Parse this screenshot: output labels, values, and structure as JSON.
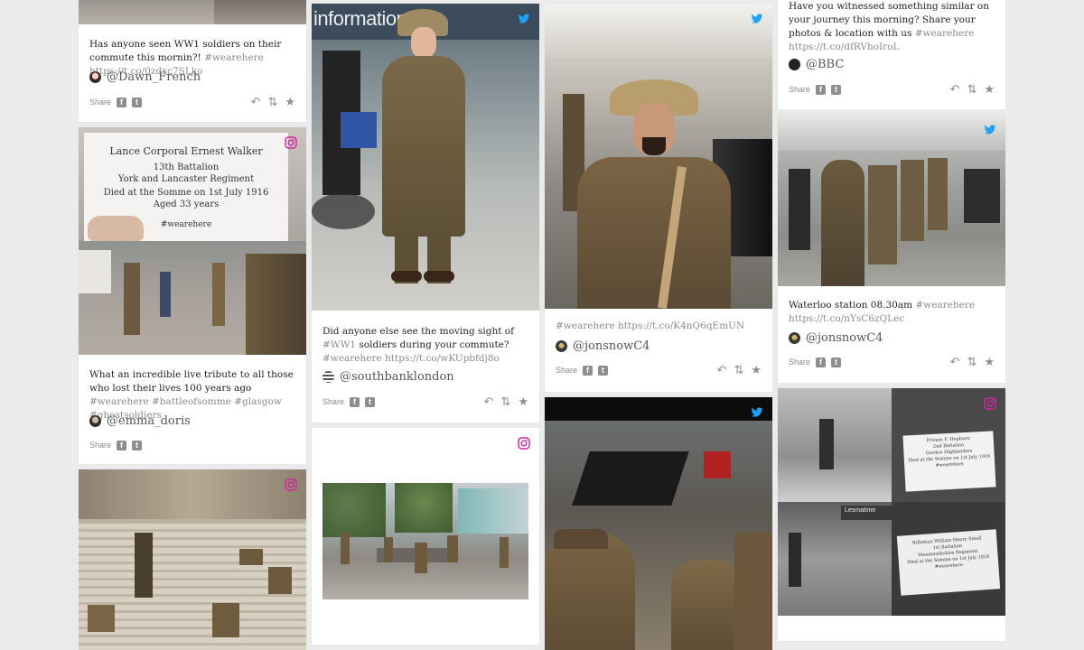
{
  "share_label": "Share",
  "colors": {
    "twitter": "#1da1f2",
    "instagram": "#d6249f",
    "background": "#ebebeb"
  },
  "cards": {
    "dawn": {
      "text": "Has anyone seen WW1 soldiers on their commute this mornin?!",
      "tags": "#wearehere https://t.co/0zdxc7SLko",
      "author": "@Dawn_French"
    },
    "ernest": {
      "note_l1": "Lance Corporal Ernest Walker",
      "note_l2": "13th Battalion",
      "note_l3": "York and Lancaster Regiment",
      "note_l4": "Died at the Somme on 1st July 1916",
      "note_l5": "Aged 33 years",
      "note_tag": "#wearehere",
      "text": "What an incredible live tribute to all those who lost their lives 100 years ago",
      "tags": "#wearehere #battleofsomme #glasgow #ghostsoldiers",
      "author": "@emma_doris"
    },
    "southbank": {
      "sign": "information",
      "text": "Did anyone else see the moving sight of",
      "tag1": "#WW1",
      "text2": "soldiers during your commute?",
      "tags": "#wearehere https://t.co/wKUpbfdj8o",
      "author": "@southbanklondon"
    },
    "jonsnow1": {
      "tags": "#wearehere https://t.co/K4nQ6qEmUN",
      "author": "@jonsnowC4"
    },
    "bbc": {
      "text": "Have you witnessed something similar on your journey this morning? Share your photos & location with us",
      "tags": "#wearehere https://t.co/dfRVhoIroL",
      "author": "@BBC"
    },
    "waterloo": {
      "text": "Waterloo station 08.30am",
      "tags": "#wearehere https://t.co/nYsC6zQLec",
      "author": "@jonsnowC4"
    },
    "hepburn": {
      "note1_l1": "Private F. Hepburn",
      "note1_l2": "2nd Battalion",
      "note1_l3": "Gordon Highlanders",
      "note1_l4": "Died at the Somme on 1st July 1916",
      "note1_l5": "#wearehere",
      "note2_l1": "Rifleman William Henry Small",
      "note2_l2": "1st Battalion",
      "note2_l3": "Monmouthshire Regiment",
      "note2_l4": "Died at the Somme on 1st July 1916",
      "note2_l5": "#wearehere",
      "shop_sign": "Lesmatime"
    }
  }
}
